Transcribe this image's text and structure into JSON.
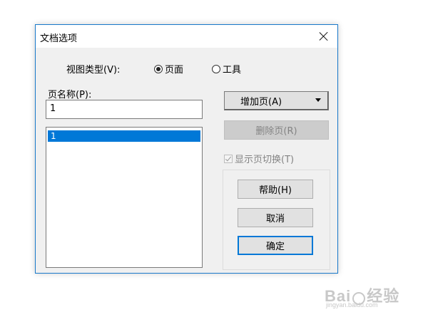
{
  "dialog": {
    "title": "文档选项",
    "view_type_label": "视图类型(V):",
    "radio_page": {
      "label": "页面",
      "checked": true
    },
    "radio_tool": {
      "label": "工具",
      "checked": false
    },
    "page_name_label": "页名称(P):",
    "page_name_value": "1",
    "page_list": [
      "1"
    ],
    "buttons": {
      "add_page": "增加页(A)",
      "delete_page": "删除页(R)",
      "help": "帮助(H)",
      "cancel": "取消",
      "ok": "确定"
    },
    "show_page_switch": {
      "label": "显示页切换(T)",
      "checked": true,
      "disabled": true
    }
  },
  "watermark": {
    "brand": "Bai",
    "brand_suffix": "经验",
    "url": "jingyan.baidu.com"
  },
  "colors": {
    "selection": "#0078d7",
    "border_accent": "#1979ca"
  }
}
